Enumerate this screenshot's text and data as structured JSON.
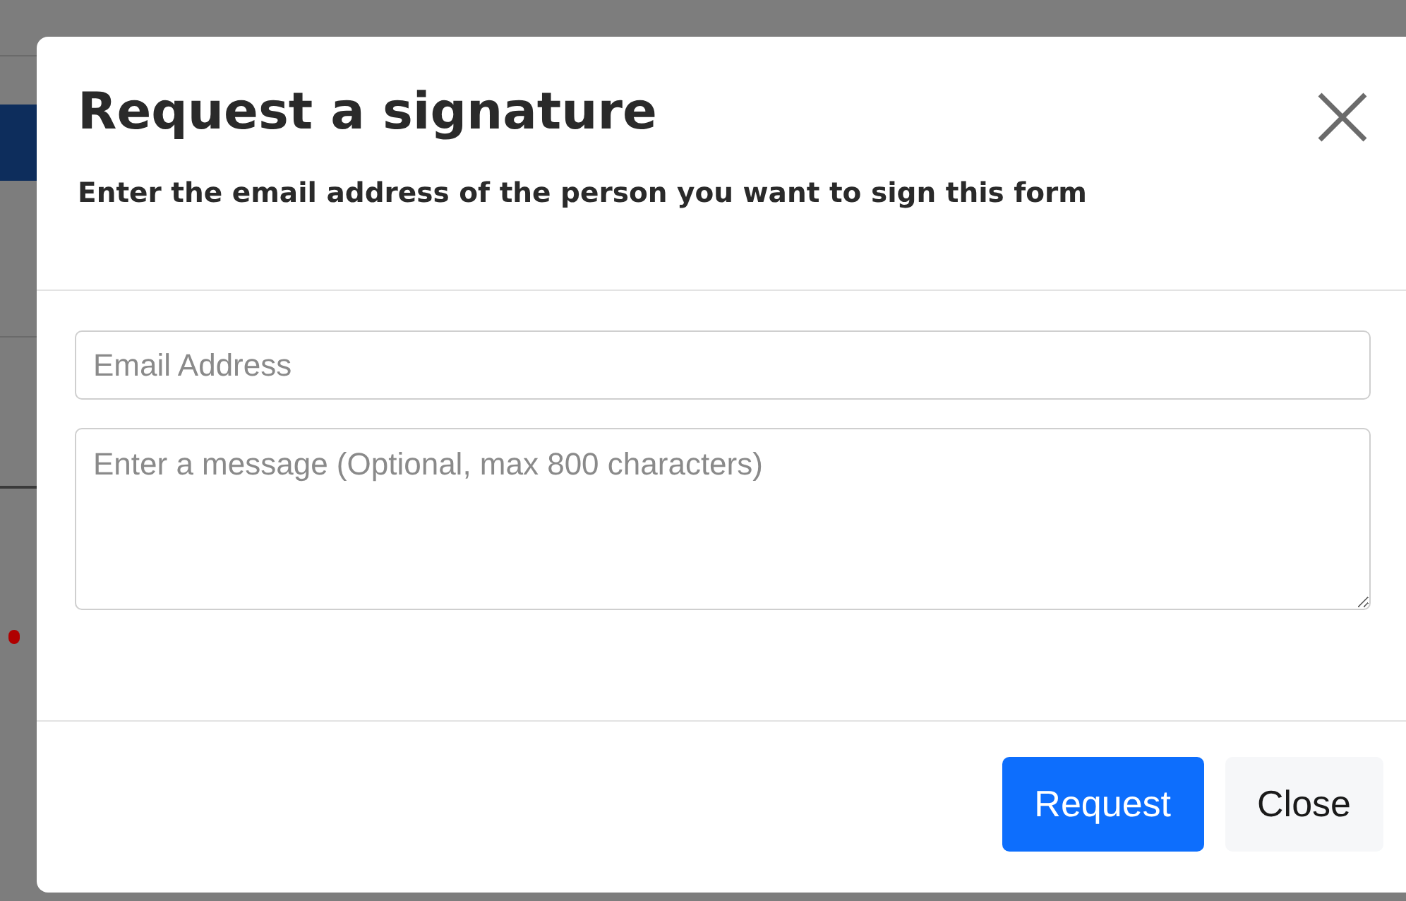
{
  "dialog": {
    "title": "Request a signature",
    "subtitle": "Enter the email address of the person you want to sign this form",
    "fields": [
      {
        "kind": "input",
        "placeholder": "Email Address"
      },
      {
        "kind": "textarea",
        "placeholder": "Enter a message (Optional, max 800 characters)"
      }
    ],
    "buttons": [
      {
        "label": "Request",
        "kind": "primary"
      },
      {
        "label": "Close",
        "kind": "secondary"
      }
    ]
  }
}
